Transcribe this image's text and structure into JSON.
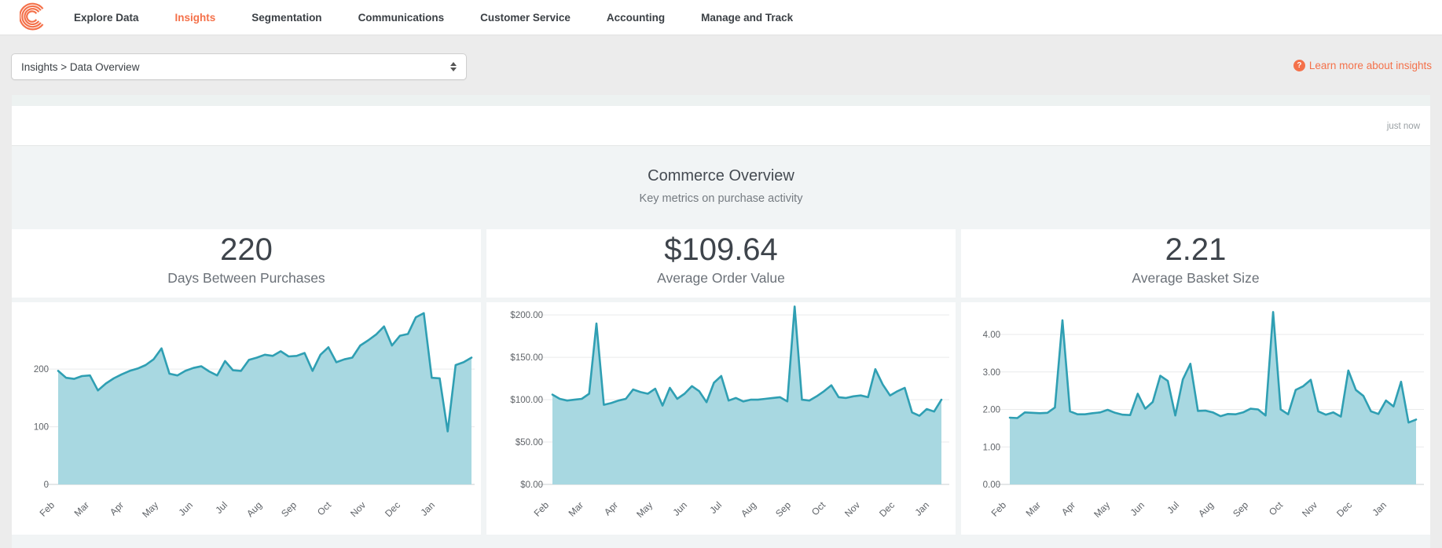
{
  "nav": {
    "items": [
      {
        "label": "Explore Data",
        "active": false
      },
      {
        "label": "Insights",
        "active": true
      },
      {
        "label": "Segmentation",
        "active": false
      },
      {
        "label": "Communications",
        "active": false
      },
      {
        "label": "Customer Service",
        "active": false
      },
      {
        "label": "Accounting",
        "active": false
      },
      {
        "label": "Manage and Track",
        "active": false
      }
    ]
  },
  "toolbar": {
    "select_value": "Insights > Data Overview",
    "help_label": "Learn more about insights"
  },
  "icons": {
    "help_glyph": "?"
  },
  "statusbar": {
    "updated": "just now"
  },
  "section": {
    "title": "Commerce Overview",
    "subtitle": "Key metrics on purchase activity"
  },
  "metrics": [
    {
      "value": "220",
      "label": "Days Between Purchases"
    },
    {
      "value": "$109.64",
      "label": "Average Order Value"
    },
    {
      "value": "2.21",
      "label": "Average Basket Size"
    }
  ],
  "colors": {
    "accent_orange": "#f4714a",
    "line_teal": "#2f9fb3",
    "fill_teal": "#a8d8e1",
    "grid": "#e9eaeb",
    "axis": "#dcdfe0",
    "tick_text": "#5f6368"
  },
  "chart_data": [
    {
      "type": "area",
      "title": "Days Between Purchases",
      "x_labels": [
        "Feb",
        "Mar",
        "Apr",
        "May",
        "Jun",
        "Jul",
        "Aug",
        "Sep",
        "Oct",
        "Nov",
        "Dec",
        "Jan"
      ],
      "y_tick_values": [
        0,
        100,
        200
      ],
      "y_tick_labels": [
        "0",
        "100",
        "200"
      ],
      "ylim": [
        0,
        316
      ],
      "grid": true,
      "legend": "none",
      "values": [
        197,
        185,
        183,
        188,
        189,
        163,
        175,
        184,
        191,
        197,
        201,
        207,
        217,
        236,
        192,
        189,
        197,
        202,
        205,
        196,
        189,
        214,
        198,
        197,
        216,
        220,
        225,
        223,
        231,
        222,
        223,
        228,
        197,
        225,
        238,
        212,
        217,
        220,
        241,
        250,
        260,
        274,
        241,
        258,
        261,
        290,
        297,
        185,
        184,
        92,
        207,
        212,
        220
      ]
    },
    {
      "type": "area",
      "title": "Average Order Value",
      "x_labels": [
        "Feb",
        "Mar",
        "Apr",
        "May",
        "Jun",
        "Jul",
        "Aug",
        "Sep",
        "Oct",
        "Nov",
        "Dec",
        "Jan"
      ],
      "y_tick_values": [
        0,
        50,
        100,
        150,
        200
      ],
      "y_tick_labels": [
        "$0.00",
        "$50.00",
        "$100.00",
        "$150.00",
        "$200.00"
      ],
      "ylim": [
        0,
        215
      ],
      "grid": true,
      "legend": "none",
      "values": [
        106,
        101,
        99,
        100,
        101,
        107,
        190,
        94,
        96,
        99,
        101,
        112,
        109,
        107,
        113,
        93,
        114,
        101,
        107,
        116,
        110,
        97,
        120,
        128,
        99,
        102,
        98,
        100,
        100,
        101,
        102,
        103,
        98,
        210,
        100,
        99,
        104,
        110,
        117,
        103,
        102,
        104,
        105,
        103,
        136,
        118,
        105,
        110,
        114,
        85,
        81,
        89,
        86,
        100
      ]
    },
    {
      "type": "area",
      "title": "Average Basket Size",
      "x_labels": [
        "Feb",
        "Mar",
        "Apr",
        "May",
        "Jun",
        "Jul",
        "Aug",
        "Sep",
        "Oct",
        "Nov",
        "Dec",
        "Jan"
      ],
      "y_tick_values": [
        0,
        1,
        2,
        3,
        4
      ],
      "y_tick_labels": [
        "0.00",
        "1.00",
        "2.00",
        "3.00",
        "4.00"
      ],
      "ylim": [
        0,
        4.86
      ],
      "grid": true,
      "legend": "none",
      "values": [
        1.78,
        1.77,
        1.92,
        1.91,
        1.9,
        1.91,
        2.05,
        4.38,
        1.95,
        1.87,
        1.87,
        1.9,
        1.92,
        1.99,
        1.91,
        1.86,
        1.85,
        2.42,
        2.02,
        2.2,
        2.9,
        2.76,
        1.84,
        2.8,
        3.22,
        1.96,
        1.97,
        1.92,
        1.82,
        1.88,
        1.87,
        1.92,
        2.02,
        2.0,
        1.84,
        4.6,
        2.0,
        1.87,
        2.52,
        2.62,
        2.79,
        1.95,
        1.86,
        1.92,
        1.81,
        3.04,
        2.52,
        2.36,
        1.95,
        1.88,
        2.24,
        2.08,
        2.74,
        1.65,
        1.73
      ]
    }
  ]
}
